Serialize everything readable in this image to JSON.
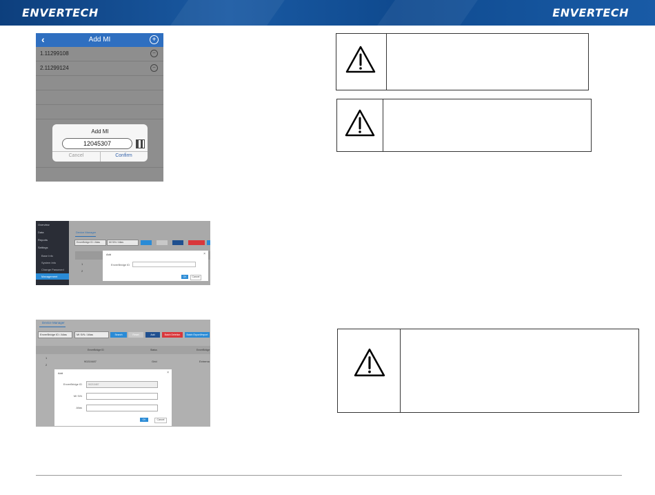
{
  "header": {
    "brand_left": "ENVERTECH",
    "brand_right": "ENVERTECH"
  },
  "phone": {
    "title": "Add MI",
    "back_icon": "chevron-left-icon",
    "add_icon": "plus-circle-icon",
    "items": [
      {
        "label": "1.11299108",
        "icon": "minus-circle-icon"
      },
      {
        "label": "2.11299124",
        "icon": "minus-circle-icon"
      }
    ],
    "dialog": {
      "title": "Add MI",
      "value": "12045307",
      "scan_icon": "qr-scan-icon",
      "cancel": "Cancel",
      "confirm": "Confirm"
    }
  },
  "web1": {
    "sidebar": [
      "Overview",
      "Data",
      "Reports",
      "Settings",
      "Base Info",
      "System Info",
      "Change Password",
      "Management"
    ],
    "tab": "Device Manager",
    "filters": [
      "EnverBridge ID / Alias",
      "MI S/N / Alias"
    ],
    "buttons": [
      "Search",
      "Reset",
      "Add",
      "Batch Deletion"
    ],
    "rows": [
      "1",
      "2"
    ],
    "dialog": {
      "title": "Add",
      "label": "EnverBridge ID",
      "ok": "OK",
      "cancel": "Cancel"
    }
  },
  "web2": {
    "tab": "Device Manager",
    "filters": [
      "EnverBridge ID / Alias",
      "MI S/N / Alias"
    ],
    "buttons": [
      "Search",
      "Reset",
      "Add",
      "Batch Deletion",
      "Batch Export/Import"
    ],
    "columns": [
      "EnverBridge ID",
      "Status",
      "EnverBridge"
    ],
    "rows": [
      "1",
      "2"
    ],
    "row_values": {
      "id": "90210487",
      "status": "Grid",
      "extra": "Extrema"
    },
    "dialog": {
      "title": "Add",
      "fields": [
        {
          "label": "EnverBridge ID",
          "value": "90210487"
        },
        {
          "label": "MI S/N",
          "value": ""
        },
        {
          "label": "Alias",
          "value": ""
        }
      ],
      "ok": "OK",
      "cancel": "Cancel"
    }
  },
  "warnings": [
    {
      "icon": "warning-triangle-icon"
    },
    {
      "icon": "warning-triangle-icon"
    },
    {
      "icon": "warning-triangle-icon"
    }
  ],
  "colors": {
    "header": "#1a5aa3",
    "accent": "#2a8bd6",
    "phone_bar": "#2f6fc0",
    "danger": "#d9373b"
  }
}
